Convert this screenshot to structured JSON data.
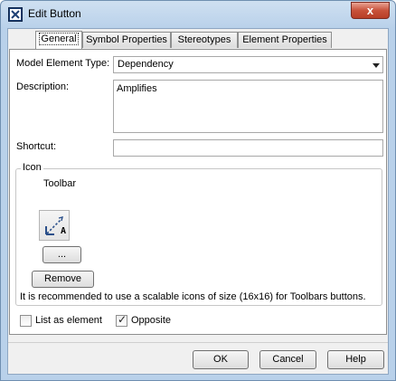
{
  "window": {
    "title": "Edit Button",
    "close_label": "x"
  },
  "tabs": [
    {
      "label": "General",
      "active": true
    },
    {
      "label": "Symbol Properties",
      "active": false
    },
    {
      "label": "Stereotypes",
      "active": false
    },
    {
      "label": "Element Properties",
      "active": false
    }
  ],
  "general": {
    "model_element_type_label": "Model Element Type:",
    "model_element_type_value": "Dependency",
    "description_label": "Description:",
    "description_value": "Amplifies",
    "shortcut_label": "Shortcut:",
    "shortcut_value": ""
  },
  "icon_group": {
    "legend": "Icon",
    "toolbar_label": "Toolbar",
    "browse_label": "...",
    "remove_label": "Remove",
    "hint": "It is recommended to use a scalable icons of size (16x16) for Toolbars buttons.",
    "icon_letter": "A"
  },
  "options": {
    "list_as_element_label": "List as element",
    "list_as_element_checked": false,
    "opposite_label": "Opposite",
    "opposite_checked": true
  },
  "buttons": {
    "ok": "OK",
    "cancel": "Cancel",
    "help": "Help"
  }
}
